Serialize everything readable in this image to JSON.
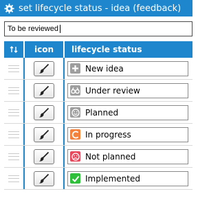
{
  "window": {
    "title": "set lifecycle status - idea (feedback)",
    "icon": "gear-icon"
  },
  "search": {
    "value": "To be reviewed"
  },
  "grid": {
    "columns": [
      {
        "label": "",
        "icon": "sort-arrows-icon"
      },
      {
        "label": "icon"
      },
      {
        "label": "lifecycle status"
      }
    ],
    "rows": [
      {
        "status": "New idea",
        "icon": "plus-icon",
        "color": "#9e9e9e"
      },
      {
        "status": "Under review",
        "icon": "binoculars-icon",
        "color": "#9e9e9e"
      },
      {
        "status": "Planned",
        "icon": "smiley-icon",
        "color": "#9e9e9e"
      },
      {
        "status": "In progress",
        "icon": "progress-icon",
        "color": "#f5823c"
      },
      {
        "status": "Not planned",
        "icon": "sad-face-icon",
        "color": "#e8485c"
      },
      {
        "status": "Implemented",
        "icon": "checkmark-icon",
        "color": "#2fbf3a"
      }
    ]
  },
  "colors": {
    "accent": "#1e86cc"
  }
}
